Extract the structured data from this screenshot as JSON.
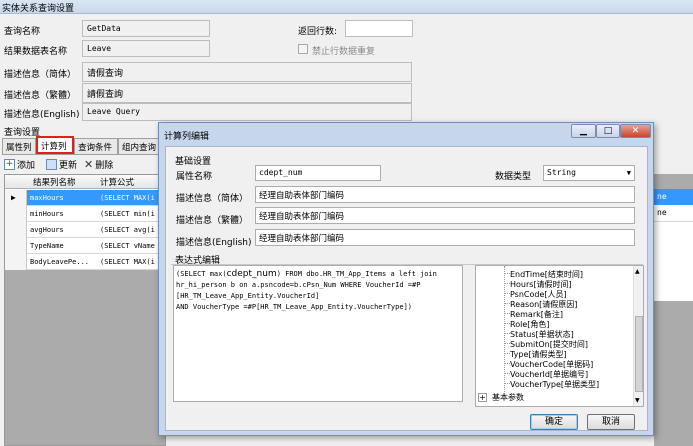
{
  "window": {
    "title": "实体关系查询设置"
  },
  "form": {
    "query_name_label": "查询名称",
    "query_name_value": "GetData",
    "return_rows_label": "返回行数:",
    "return_rows_value": "",
    "result_table_label": "结果数据表名称",
    "result_table_value": "Leave",
    "no_duplicate_label": "禁止行数据重复",
    "desc_simplified_label": "描述信息（简体）",
    "desc_simplified_value": "请假查询",
    "desc_traditional_label": "描述信息（繁體）",
    "desc_traditional_value": "請假查詢",
    "desc_english_label": "描述信息(English)",
    "desc_english_value": "Leave Query",
    "query_settings_label": "查询设置"
  },
  "tabs": [
    "属性列",
    "计算列",
    "查询条件",
    "组内查询"
  ],
  "toolbar": {
    "add": "添加",
    "update": "更新",
    "delete": "删除"
  },
  "grid": {
    "headers": [
      "结果列名称",
      "计算公式"
    ],
    "rows": [
      {
        "name": "maxHours",
        "formula": "(SELECT MAX(i"
      },
      {
        "name": "minHours",
        "formula": "(SELECT min(i"
      },
      {
        "name": "avgHours",
        "formula": "(SELECT avg(i"
      },
      {
        "name": "TypeName",
        "formula": "(SELECT vName"
      },
      {
        "name": "BodyLeavePe...",
        "formula": "(SELECT MAX(i"
      }
    ]
  },
  "right_strip": {
    "row1": "ne",
    "row2": "ne"
  },
  "dialog": {
    "title": "计算列编辑",
    "basic_section": "基础设置",
    "prop_name_label": "属性名称",
    "prop_name_value": "cdept_num",
    "data_type_label": "数据类型",
    "data_type_value": "String",
    "desc_simplified_label": "描述信息（简体）",
    "desc_simplified_value": "经理自助表体部门编码",
    "desc_traditional_label": "描述信息（繁體）",
    "desc_traditional_value": "经理自助表体部门编码",
    "desc_english_label": "描述信息(English)",
    "desc_english_value": "经理自助表体部门编码",
    "expr_section": "表达式编辑",
    "expr_line1a": "(SELECT max(",
    "expr_line1b": "cdept_num",
    "expr_line1c": ") FROM dbo.HR_TM_App_Items a left join",
    "expr_line2": "hr_hi_person b on a.psncode=b.cPsn_Num WHERE VoucherId =#P",
    "expr_line3": "[HR_TM_Leave_App_Entity.VoucherId]",
    "expr_line4": " AND VoucherType =#P[HR_TM_Leave_App_Entity.VoucherType])",
    "tree_items": [
      "EndTime[结束时间]",
      "Hours[请假时间]",
      "PsnCode[人员]",
      "Reason[请假原因]",
      "Remark[备注]",
      "Role[角色]",
      "Status[单据状态]",
      "SubmitOn[提交时间]",
      "Type[请假类型]",
      "VoucherCode[单据码]",
      "VoucherId[单据编号]",
      "VoucherType[单据类型]"
    ],
    "tree_group": "基本参数",
    "ok_label": "确定",
    "cancel_label": "取消",
    "min_glyph": "▁",
    "max_glyph": "□",
    "close_glyph": "✕"
  }
}
